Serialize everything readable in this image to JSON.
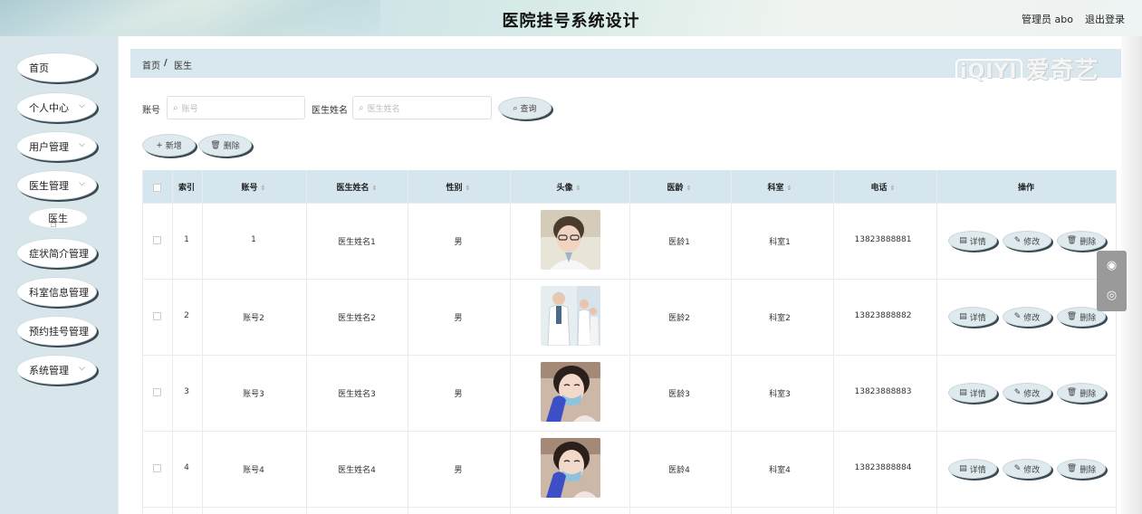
{
  "header": {
    "title": "医院挂号系统设计",
    "user": "管理员 abo",
    "logout": "退出登录"
  },
  "sidebar": {
    "items": [
      {
        "label": "首页",
        "chevron": false
      },
      {
        "label": "个人中心",
        "chevron": true
      },
      {
        "label": "用户管理",
        "chevron": true
      },
      {
        "label": "医生管理",
        "chevron": true
      },
      {
        "label": "症状简介管理",
        "chevron": false
      },
      {
        "label": "科室信息管理",
        "chevron": false
      },
      {
        "label": "预约挂号管理",
        "chevron": false
      },
      {
        "label": "系统管理",
        "chevron": true
      }
    ],
    "subitem": "医生"
  },
  "breadcrumb": {
    "home": "首页",
    "sep": "/",
    "current": "医生"
  },
  "search": {
    "account_label": "账号",
    "account_placeholder": "账号",
    "name_label": "医生姓名",
    "name_placeholder": "医生姓名",
    "query_button": "查询"
  },
  "toolbar": {
    "add": "新增",
    "delete": "删除"
  },
  "table": {
    "headers": [
      "索引",
      "账号",
      "医生姓名",
      "性别",
      "头像",
      "医龄",
      "科室",
      "电话",
      "操作"
    ],
    "rows": [
      {
        "index": "1",
        "account": "1",
        "name": "医生姓名1",
        "gender": "男",
        "age": "医龄1",
        "dept": "科室1",
        "phone": "13823888881"
      },
      {
        "index": "2",
        "account": "账号2",
        "name": "医生姓名2",
        "gender": "男",
        "age": "医龄2",
        "dept": "科室2",
        "phone": "13823888882"
      },
      {
        "index": "3",
        "account": "账号3",
        "name": "医生姓名3",
        "gender": "男",
        "age": "医龄3",
        "dept": "科室3",
        "phone": "13823888883"
      },
      {
        "index": "4",
        "account": "账号4",
        "name": "医生姓名4",
        "gender": "男",
        "age": "医龄4",
        "dept": "科室4",
        "phone": "13823888884"
      }
    ],
    "actions": {
      "detail": "详情",
      "edit": "修改",
      "delete": "删除"
    }
  },
  "watermark": {
    "logo": "iQIYI",
    "text": "爱奇艺"
  }
}
